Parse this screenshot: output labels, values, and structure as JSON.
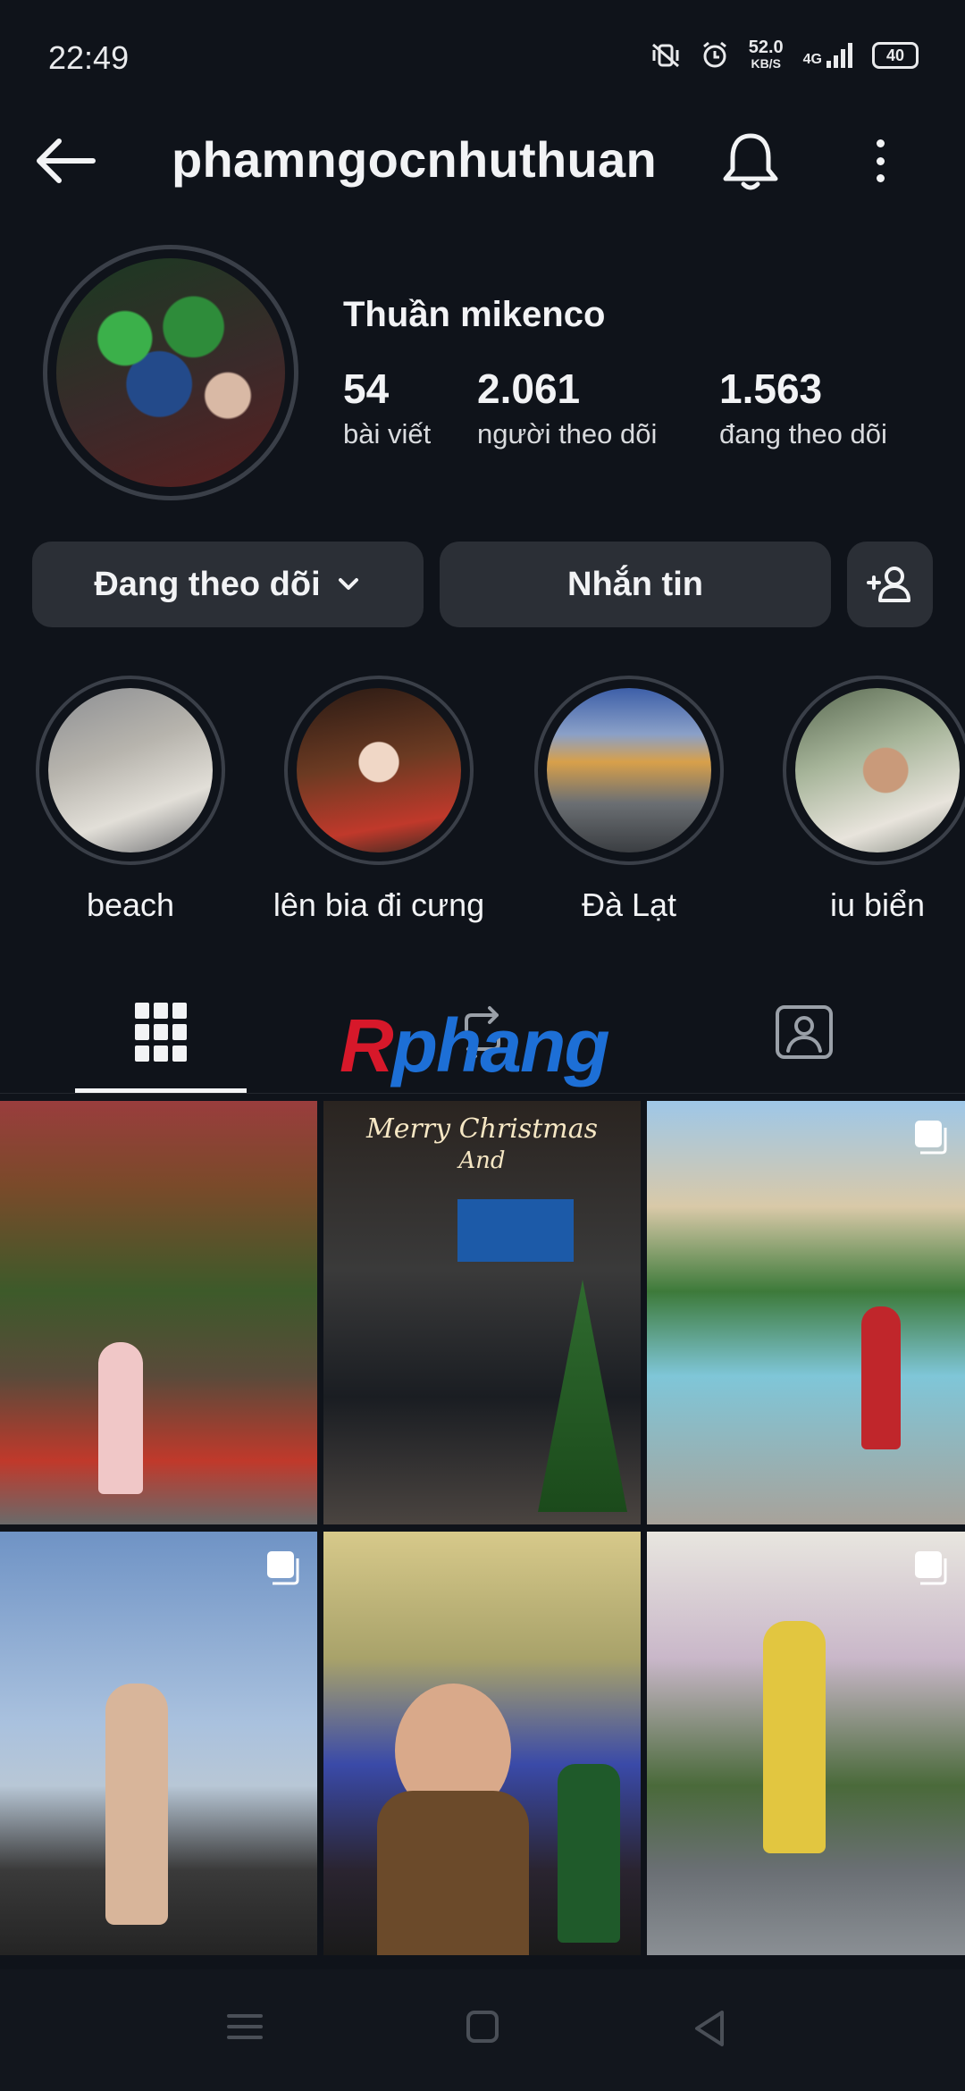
{
  "status_bar": {
    "time": "22:49",
    "net_speed_value": "52.0",
    "net_speed_unit": "KB/S",
    "network": "4G",
    "battery": "40",
    "icons": [
      "mute-vibrate-icon",
      "alarm-icon",
      "signal-icon",
      "battery-icon"
    ]
  },
  "header": {
    "username": "phamngocnhuthuan",
    "icons": [
      "back-arrow-icon",
      "bell-icon",
      "more-vertical-icon"
    ]
  },
  "profile": {
    "display_name": "Thuần mikenco",
    "stats": [
      {
        "value": "54",
        "label": "bài viết"
      },
      {
        "value": "2.061",
        "label": "người theo dõi"
      },
      {
        "value": "1.563",
        "label": "đang theo dõi"
      }
    ]
  },
  "actions": {
    "following_label": "Đang theo dõi",
    "message_label": "Nhắn tin"
  },
  "highlights": [
    {
      "label": "beach"
    },
    {
      "label": "lên bia đi cưng"
    },
    {
      "label": "Đà Lạt"
    },
    {
      "label": "iu biển"
    }
  ],
  "tabs": [
    "grid-icon",
    "reels-icon",
    "tagged-icon"
  ],
  "watermark": {
    "part1": "R",
    "part2": "phang"
  },
  "grid_overlay_text": {
    "tile2_line1": "Merry Christmas",
    "tile2_line2": "And"
  },
  "colors": {
    "background": "#0f131a",
    "button_bg": "#2b2f36",
    "text": "#f2f3f5"
  }
}
